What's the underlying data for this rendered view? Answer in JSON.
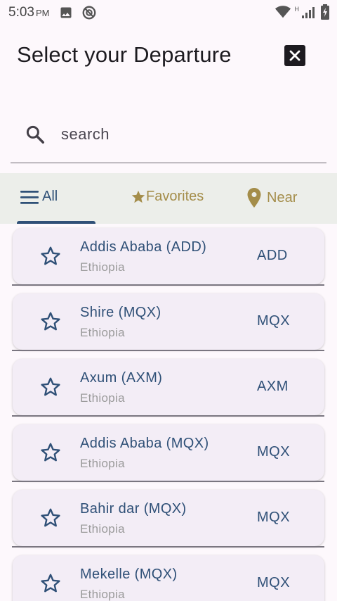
{
  "status_bar": {
    "time": "5:03",
    "ampm": "PM",
    "network_label": "H"
  },
  "header": {
    "title": "Select your Departure"
  },
  "search": {
    "placeholder": "search",
    "value": ""
  },
  "tabs": [
    {
      "label": "All",
      "icon": "menu-icon",
      "active": true
    },
    {
      "label": "Favorites",
      "icon": "star-icon",
      "active": false
    },
    {
      "label": "Near",
      "icon": "location-pin-icon",
      "active": false
    }
  ],
  "airports": [
    {
      "name": "Addis Ababa (ADD)",
      "country": "Ethiopia",
      "code": "ADD"
    },
    {
      "name": "Shire (MQX)",
      "country": "Ethiopia",
      "code": "MQX"
    },
    {
      "name": "Axum (AXM)",
      "country": "Ethiopia",
      "code": "AXM"
    },
    {
      "name": "Addis Ababa (MQX)",
      "country": "Ethiopia",
      "code": "MQX"
    },
    {
      "name": "Bahir dar (MQX)",
      "country": "Ethiopia",
      "code": "MQX"
    },
    {
      "name": "Mekelle (MQX)",
      "country": "Ethiopia",
      "code": "MQX"
    }
  ],
  "colors": {
    "primary": "#2f5077",
    "accent_gold": "#a48d4a",
    "background": "#fdf8fc",
    "card": "#f3edf6",
    "tab_bar": "#eceeea"
  }
}
